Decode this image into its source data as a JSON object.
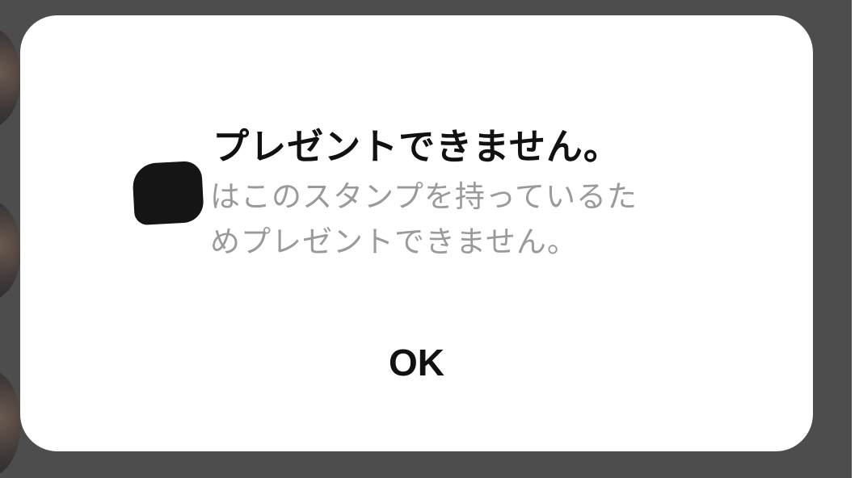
{
  "dialog": {
    "title": "プレゼントできません。",
    "message_line1": "はこのスタンプを持っているた",
    "message_line2": "めプレゼントできません。",
    "ok_label": "OK"
  },
  "colors": {
    "overlay": "#4d4d4d",
    "dialog_background": "#ffffff",
    "title_text": "#111111",
    "message_text": "#9a9a9a"
  }
}
